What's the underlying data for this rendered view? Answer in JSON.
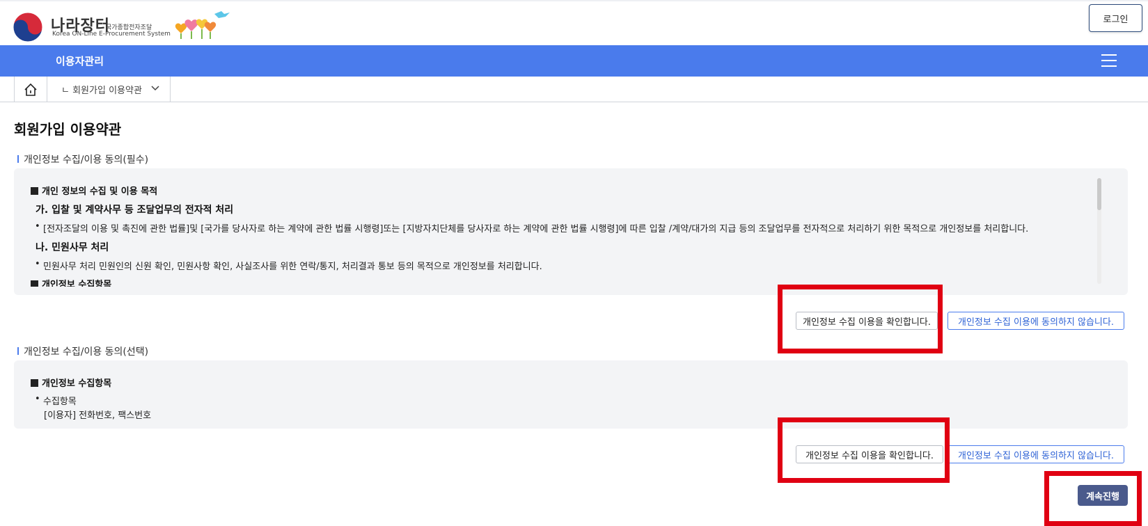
{
  "header": {
    "logo_main": "나라장터",
    "logo_sub": "국가종합전자조달",
    "logo_en": "Korea ON-Line E-Procurement System",
    "login_label": "로그인"
  },
  "nav": {
    "title": "이용자관리"
  },
  "breadcrumb": {
    "current": "ㄴ 회원가입 이용약관"
  },
  "page": {
    "title": "회원가입 이용약관"
  },
  "section_required": {
    "label": "개인정보 수집/이용 동의(필수)",
    "heading1": "개인 정보의 수집 및 이용 목적",
    "sub_a": "가. 입찰 및 계약사무 등 조달업무의 전자적 처리",
    "bullet_a": "[전자조달의 이용 및 촉진에 관한 법률]및 [국가를 당사자로 하는 계약에 관한 법률 시행령]또는 [지방자치단체를 당사자로 하는 계약에 관한 법률 시행령]에 따른 입찰 /계약/대가의 지급 등의 조달업무를 전자적으로 처리하기 위한 목적으로 개인정보를 처리합니다.",
    "sub_b": "나. 민원사무 처리",
    "bullet_b": "민원사무 처리 민원인의 신원 확인, 민원사항 확인, 사실조사를 위한 연락/통지, 처리결과 통보 등의 목적으로 개인정보를 처리합니다.",
    "heading2": "개인정보 수집항목",
    "agree_label": "개인정보 수집 이용을 확인합니다.",
    "disagree_label": "개인정보 수집 이용에 동의하지 않습니다."
  },
  "section_optional": {
    "label": "개인정보 수집/이용 동의(선택)",
    "heading": "개인정보 수집항목",
    "bullet": "수집항목",
    "detail": "[이용자] 전화번호, 팩스번호",
    "agree_label": "개인정보 수집 이용을 확인합니다.",
    "disagree_label": "개인정보 수집 이용에 동의하지 않습니다."
  },
  "continue_label": "계속진행",
  "colors": {
    "nav_blue": "#4a7bec",
    "highlight_red": "#e00012",
    "continue_btn": "#4a5a8c"
  }
}
